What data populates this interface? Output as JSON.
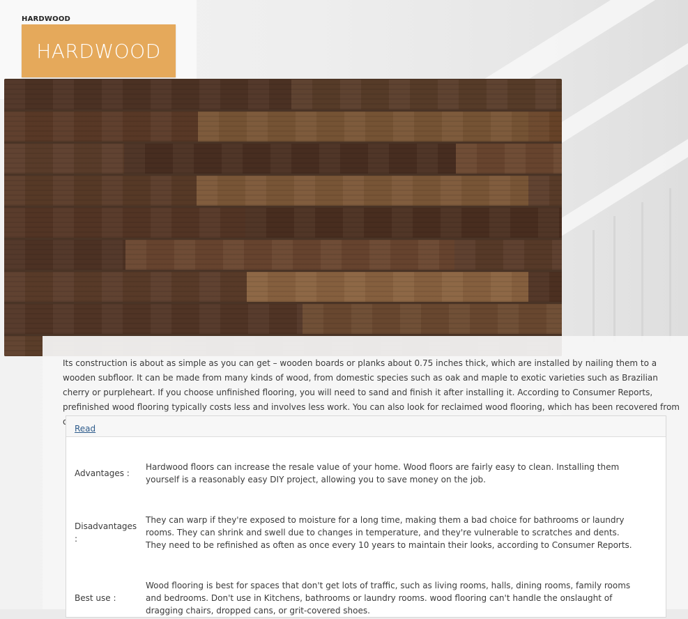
{
  "header": {
    "small_title": "HARDWOOD",
    "badge_text": "HARDWOOD"
  },
  "colors": {
    "badge": "#e5a95b",
    "link": "#2d5b8b"
  },
  "intro_text": "Its construction is about as simple as you can get – wooden boards or planks about 0.75 inches thick, which are installed by nailing them to a wooden subfloor. It can be made from many kinds of wood, from domestic species such as oak and maple to exotic varieties such as Brazilian cherry or purpleheart. If you choose unfinished flooring, you will need to sand and finish it after installing it. According to Consumer Reports, prefinished wood flooring typically costs less and involves less work. You can also look for reclaimed wood flooring, which has been recovered from old buildings that have been torn down.",
  "card": {
    "link_label": "Read",
    "rows": [
      {
        "label": "Advantages :",
        "value": "Hardwood floors can increase the resale value of your home. Wood floors are fairly easy to clean. Installing them yourself is a reasonably easy DIY project, allowing you to save money on the job."
      },
      {
        "label": "Disadvantages :",
        "value": "They can warp if they're exposed to moisture for a long time, making them a bad choice for bathrooms or laundry rooms. They can shrink and swell due to changes in temperature, and they're vulnerable to scratches and dents. They need to be refinished as often as once every 10 years to maintain their looks, according to Consumer Reports."
      },
      {
        "label": "Best use :",
        "value": "Wood flooring is best for spaces that don't get lots of traffic, such as living rooms, halls, dining rooms, family rooms and bedrooms. Don't use in Kitchens, bathrooms or laundry rooms. wood flooring can't handle the onslaught of dragging chairs, dropped cans, or grit-covered shoes."
      }
    ]
  }
}
